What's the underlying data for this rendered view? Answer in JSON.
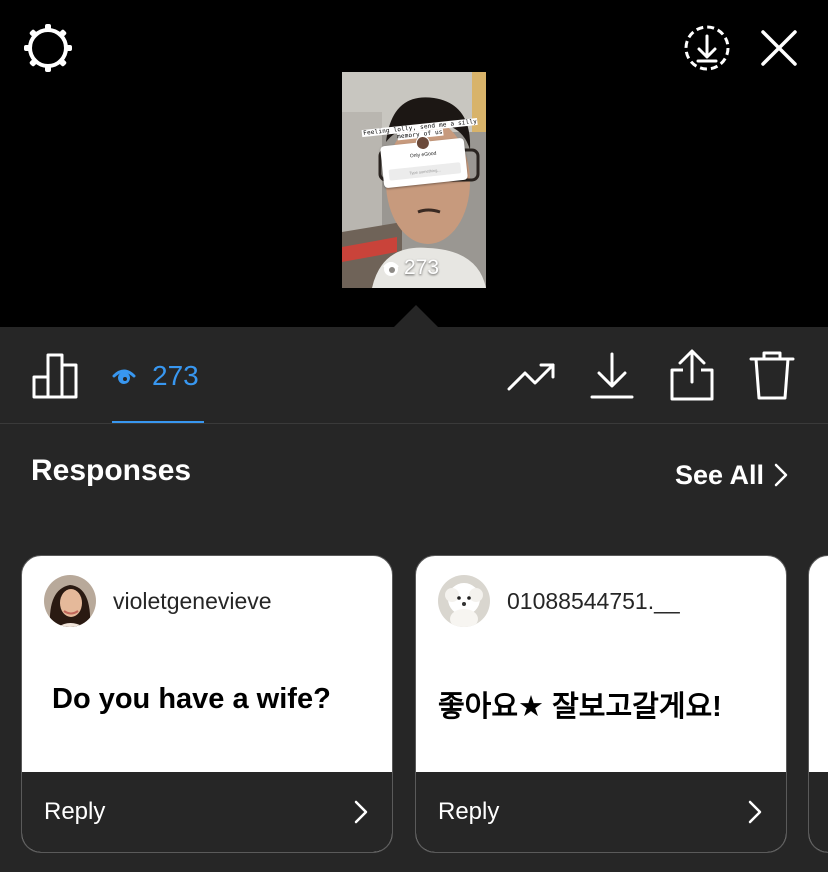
{
  "header": {
    "settings_icon": "gear-icon",
    "download_icon": "download-circle-icon",
    "close_icon": "close-icon"
  },
  "story_preview": {
    "caption": "Feeling lolly, send me a silly memory of us",
    "question_title": "Only eGood",
    "question_placeholder": "Type something...",
    "view_count": "273"
  },
  "toolbar": {
    "insights_icon": "bar-chart-icon",
    "viewers_count": "273",
    "accent_color": "#3897f0",
    "promote_icon": "trending-icon",
    "save_icon": "download-icon",
    "share_icon": "share-icon",
    "delete_icon": "trash-icon"
  },
  "responses": {
    "title": "Responses",
    "see_all": "See All",
    "cards": [
      {
        "username": "violetgenevieve",
        "text": "Do you have a wife?",
        "reply_label": "Reply"
      },
      {
        "username": "01088544751.__",
        "text": "좋아요★ 잘보고갈게요!",
        "reply_label": "Reply"
      }
    ]
  }
}
